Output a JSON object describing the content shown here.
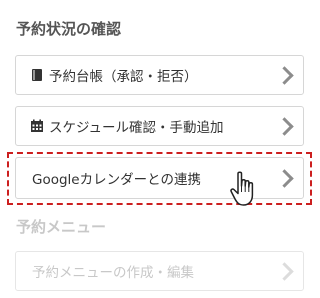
{
  "sections": [
    {
      "heading": "予約状況の確認",
      "items": [
        {
          "label": "予約台帳（承認・拒否）",
          "icon": "book-icon"
        },
        {
          "label": "スケジュール確認・手動追加",
          "icon": "calendar-icon"
        },
        {
          "label": "Googleカレンダーとの連携",
          "icon": null
        }
      ]
    },
    {
      "heading": "予約メニュー",
      "items": [
        {
          "label": "予約メニューの作成・編集",
          "icon": null
        }
      ]
    }
  ],
  "colors": {
    "heading": "#555555",
    "muted": "#c8c8c8",
    "highlight_border": "#cc1f1f",
    "chevron": "#8c8c8c"
  }
}
